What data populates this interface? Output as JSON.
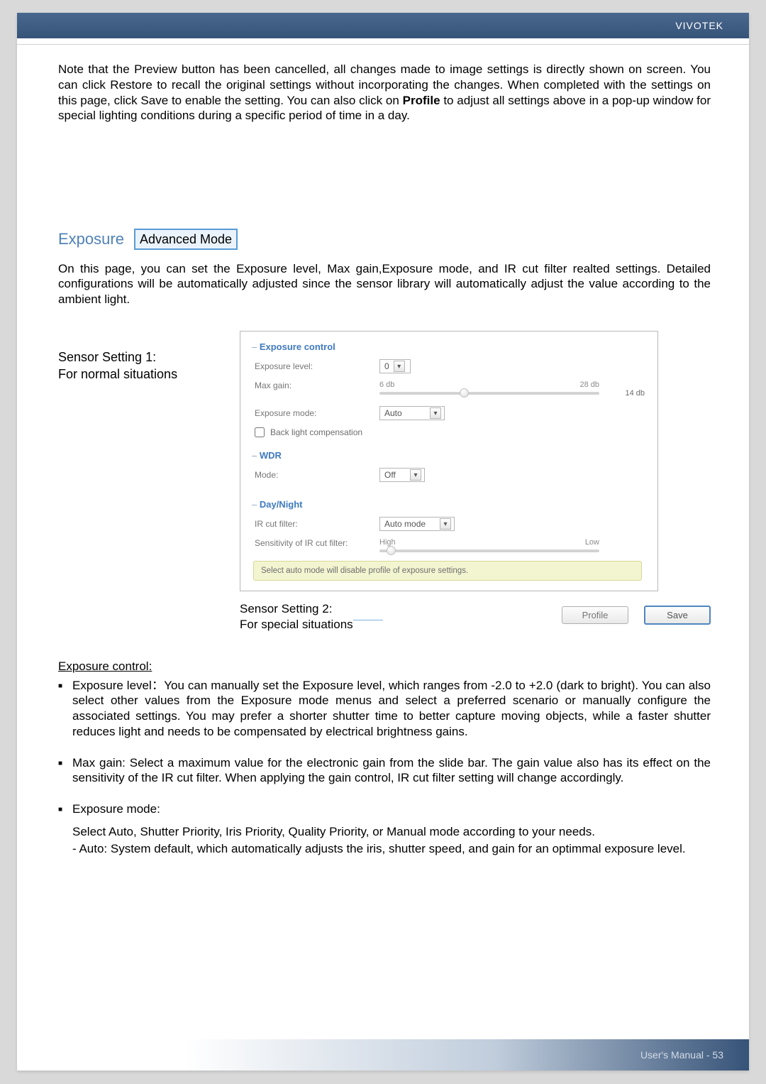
{
  "header": {
    "brand": "VIVOTEK"
  },
  "intro_paragraph": "Note that the Preview button has been cancelled, all changes made to image settings is directly shown on screen. You can click Restore to recall the original settings without incorporating the changes. When completed with the settings on this page, click Save to enable the setting. You can also click on Profile to adjust all settings above in a pop-up window for special lighting conditions during a specific period of time in a day.",
  "exposure": {
    "heading": "Exposure",
    "badge": "Advanced Mode",
    "paragraph": "On this page, you can set the Exposure level, Max gain,Exposure mode, and IR cut filter realted settings. Detailed configurations will be automatically adjusted since the sensor library will automatically adjust the value according to the ambient light."
  },
  "sensor1": {
    "line1": "Sensor Setting 1:",
    "line2": "For normal situations"
  },
  "panel": {
    "exposure_control": {
      "title": "Exposure control",
      "level_label": "Exposure level:",
      "level_value": "0",
      "maxgain_label": "Max gain:",
      "gain_min": "6 db",
      "gain_max": "28 db",
      "gain_value": "14 db",
      "mode_label": "Exposure mode:",
      "mode_value": "Auto",
      "blc_label": "Back light compensation"
    },
    "wdr": {
      "title": "WDR",
      "mode_label": "Mode:",
      "mode_value": "Off"
    },
    "dn": {
      "title": "Day/Night",
      "ir_label": "IR cut filter:",
      "ir_value": "Auto mode",
      "sens_label": "Sensitivity of IR cut filter:",
      "sens_high": "High",
      "sens_low": "Low"
    },
    "note": "Select auto mode will disable profile of exposure settings."
  },
  "sensor2": {
    "line1": "Sensor Setting 2:",
    "line2": "For special situations"
  },
  "buttons": {
    "profile": "Profile",
    "save": "Save"
  },
  "expctrl_h": "Exposure control:",
  "bullets": {
    "level": "Exposure level：You can manually set the Exposure level, which ranges from -2.0 to +2.0 (dark to bright). You can also select other values from the Exposure mode menus and select a preferred scenario or manually configure the associated settings. You may prefer a shorter shutter time to better capture moving objects, while a faster shutter reduces light and needs to be compensated by electrical brightness gains.",
    "maxgain": "Max gain: Select a maximum value for the electronic gain from the slide bar. The gain value also has its effect on the sensitivity of the IR cut filter. When applying the gain control, IR cut filter setting will change accordingly.",
    "mode": "Exposure mode:",
    "mode_sub1": "Select Auto, Shutter Priority, Iris Priority, Quality Priority, or Manual mode according to your needs.",
    "mode_sub2": "- Auto:  System default, which automatically adjusts the iris, shutter speed, and gain for an optimmal exposure level."
  },
  "footer": {
    "text": "User's Manual - 53"
  }
}
